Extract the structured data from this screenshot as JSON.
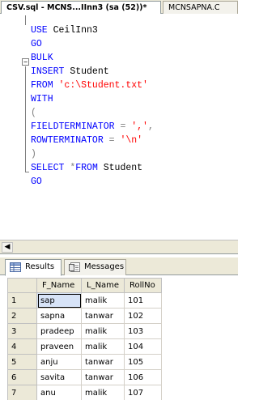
{
  "tabs": {
    "active_label": "CSV.sql - MCNS...IInn3 (sa (52))*",
    "inactive_label": "MCNSAPNA.C"
  },
  "editor": {
    "lines": [
      [
        {
          "t": "USE",
          "c": "kw"
        },
        {
          "t": " CeilInn3",
          "c": "plain"
        }
      ],
      [
        {
          "t": "GO",
          "c": "kw"
        }
      ],
      [
        {
          "t": "BULK",
          "c": "kw"
        }
      ],
      [
        {
          "t": "INSERT",
          "c": "kw"
        },
        {
          "t": " Student",
          "c": "plain"
        }
      ],
      [
        {
          "t": "FROM",
          "c": "kw"
        },
        {
          "t": " ",
          "c": "plain"
        },
        {
          "t": "'c:\\Student.txt'",
          "c": "str"
        }
      ],
      [
        {
          "t": "WITH",
          "c": "kw"
        }
      ],
      [
        {
          "t": "(",
          "c": "op"
        }
      ],
      [
        {
          "t": "FIELDTERMINATOR",
          "c": "kw"
        },
        {
          "t": " ",
          "c": "plain"
        },
        {
          "t": "=",
          "c": "op"
        },
        {
          "t": " ",
          "c": "plain"
        },
        {
          "t": "','",
          "c": "str"
        },
        {
          "t": ",",
          "c": "op"
        }
      ],
      [
        {
          "t": "ROWTERMINATOR",
          "c": "kw"
        },
        {
          "t": " ",
          "c": "plain"
        },
        {
          "t": "=",
          "c": "op"
        },
        {
          "t": " ",
          "c": "plain"
        },
        {
          "t": "'\\n'",
          "c": "str"
        }
      ],
      [
        {
          "t": ")",
          "c": "op"
        }
      ],
      [
        {
          "t": "SELECT",
          "c": "kw"
        },
        {
          "t": " ",
          "c": "plain"
        },
        {
          "t": "*",
          "c": "op"
        },
        {
          "t": "FROM",
          "c": "kw"
        },
        {
          "t": " Student",
          "c": "plain"
        }
      ],
      [
        {
          "t": "GO",
          "c": "kw"
        }
      ]
    ]
  },
  "results": {
    "results_tab_label": "Results",
    "messages_tab_label": "Messages",
    "columns": [
      "F_Name",
      "L_Name",
      "RollNo"
    ],
    "rows": [
      {
        "n": "1",
        "cells": [
          "sap",
          "malik",
          "101"
        ]
      },
      {
        "n": "2",
        "cells": [
          "sapna",
          "tanwar",
          "102"
        ]
      },
      {
        "n": "3",
        "cells": [
          "pradeep",
          "malik",
          "103"
        ]
      },
      {
        "n": "4",
        "cells": [
          "praveen",
          "malik",
          "104"
        ]
      },
      {
        "n": "5",
        "cells": [
          "anju",
          "tanwar",
          "105"
        ]
      },
      {
        "n": "6",
        "cells": [
          "savita",
          "tanwar",
          "106"
        ]
      },
      {
        "n": "7",
        "cells": [
          "anu",
          "malik",
          "107"
        ]
      }
    ]
  },
  "colors": {
    "keyword": "#0000ff",
    "string": "#ff0000",
    "operator": "#808080",
    "chrome": "#ece9d8"
  },
  "icons": {
    "results_icon": "grid-icon",
    "messages_icon": "messages-icon",
    "collapse_icon": "minus-box-icon",
    "scroll_left_icon": "chevron-left-icon"
  }
}
